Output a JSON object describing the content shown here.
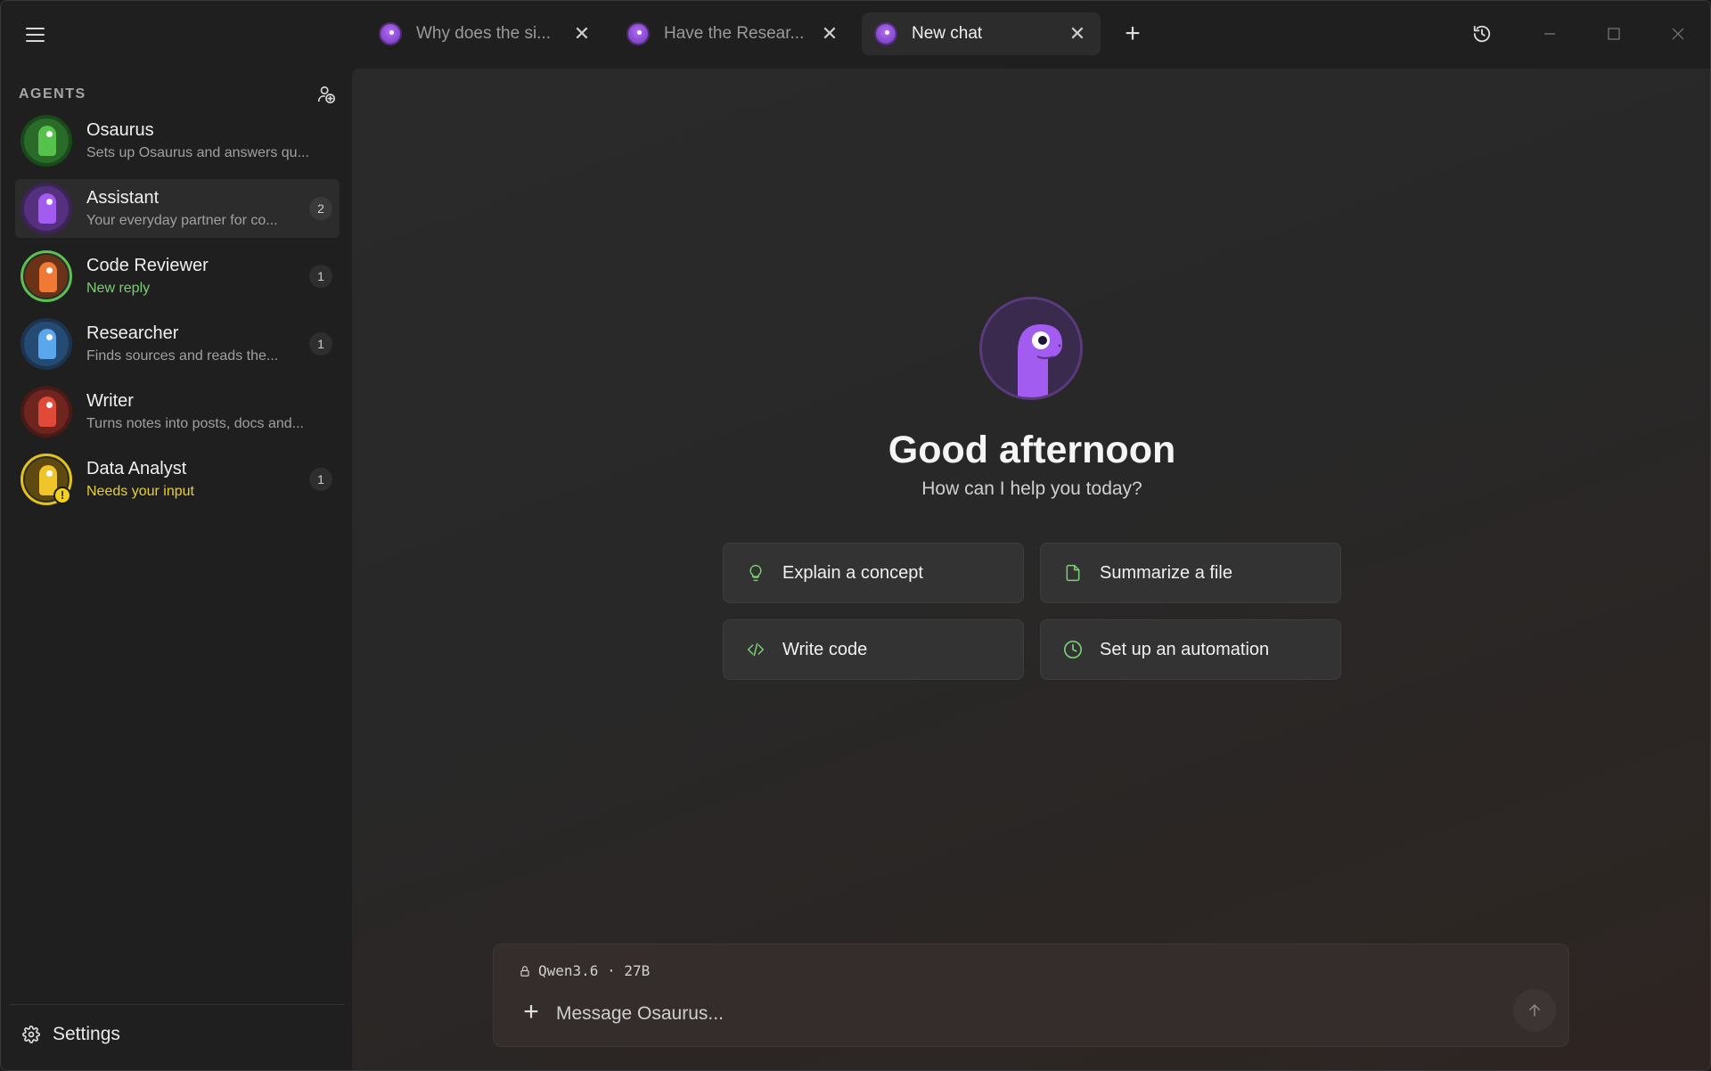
{
  "window": {
    "menu_icon": "hamburger-icon",
    "tabs": [
      {
        "label": "Why does the si...",
        "icon": "assistant-avatar-icon",
        "active": false
      },
      {
        "label": "Have the Resear...",
        "icon": "assistant-avatar-icon",
        "active": false
      },
      {
        "label": "New chat",
        "icon": "assistant-avatar-icon",
        "active": true
      }
    ],
    "new_tab_icon": "plus-icon",
    "history_icon": "history-icon",
    "controls": [
      "minimize-icon",
      "maximize-icon",
      "close-icon"
    ]
  },
  "sidebar": {
    "title": "AGENTS",
    "add_icon": "add-agent-icon",
    "agents": [
      {
        "name": "Osaurus",
        "subtitle": "Sets up Osaurus and answers qu...",
        "badge": "",
        "color": "#3fae3a",
        "status": "normal"
      },
      {
        "name": "Assistant",
        "subtitle": "Your everyday partner for co...",
        "badge": "2",
        "color": "#8c4ad9",
        "status": "normal"
      },
      {
        "name": "Code Reviewer",
        "subtitle": "New reply",
        "badge": "1",
        "color": "#e06b2c",
        "status": "new"
      },
      {
        "name": "Researcher",
        "subtitle": "Finds sources and reads the...",
        "badge": "1",
        "color": "#3f88d6",
        "status": "normal"
      },
      {
        "name": "Writer",
        "subtitle": "Turns notes into posts, docs and...",
        "badge": "",
        "color": "#d64232",
        "status": "normal"
      },
      {
        "name": "Data Analyst",
        "subtitle": "Needs your input",
        "badge": "1",
        "color": "#e2b51b",
        "status": "needs-input"
      }
    ],
    "settings_label": "Settings",
    "settings_icon": "gear-icon"
  },
  "main": {
    "greeting": "Good afternoon",
    "subgreeting": "How can I help you today?",
    "suggestions": [
      {
        "label": "Explain a concept",
        "icon": "lightbulb-icon"
      },
      {
        "label": "Summarize a file",
        "icon": "file-icon"
      },
      {
        "label": "Write code",
        "icon": "code-icon"
      },
      {
        "label": "Set up an automation",
        "icon": "clock-icon"
      }
    ],
    "composer": {
      "model": "Qwen3.6 · 27B",
      "lock_icon": "lock-icon",
      "attach_icon": "plus-icon",
      "placeholder": "Message Osaurus...",
      "send_icon": "arrow-up-icon"
    }
  },
  "colors": {
    "accent": "#7ccf74",
    "warning": "#e8cf2e",
    "brand_purple": "#8c4ad9"
  }
}
